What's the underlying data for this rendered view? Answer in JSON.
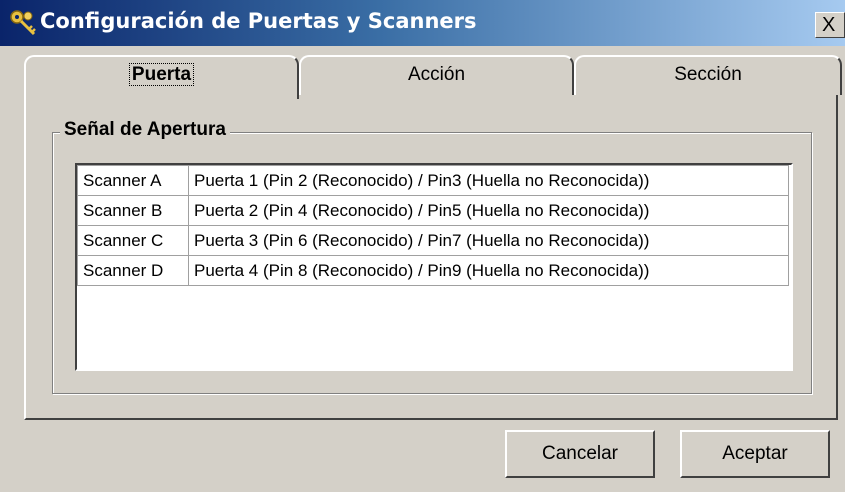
{
  "window": {
    "title": "Configuración de Puertas y Scanners",
    "close_label": "X"
  },
  "tabs": [
    {
      "label": "Puerta",
      "active": true
    },
    {
      "label": "Acción",
      "active": false
    },
    {
      "label": "Sección",
      "active": false
    }
  ],
  "group": {
    "title": "Señal de Apertura"
  },
  "scanner_list": {
    "rows": [
      {
        "scanner": "Scanner A",
        "description": "Puerta 1 (Pin 2 (Reconocido) /  Pin3 (Huella no Reconocida))"
      },
      {
        "scanner": "Scanner B",
        "description": "Puerta 2 (Pin 4 (Reconocido) /  Pin5 (Huella no Reconocida))"
      },
      {
        "scanner": "Scanner C",
        "description": "Puerta 3 (Pin 6 (Reconocido) /  Pin7 (Huella no Reconocida))"
      },
      {
        "scanner": "Scanner D",
        "description": "Puerta 4 (Pin 8 (Reconocido) /  Pin9 (Huella no Reconocida))"
      }
    ]
  },
  "buttons": {
    "cancel_label": "Cancelar",
    "accept_label": "Aceptar"
  },
  "colors": {
    "titlebar_start": "#0a246a",
    "titlebar_end": "#a6caf0",
    "face": "#d4d0c8"
  }
}
